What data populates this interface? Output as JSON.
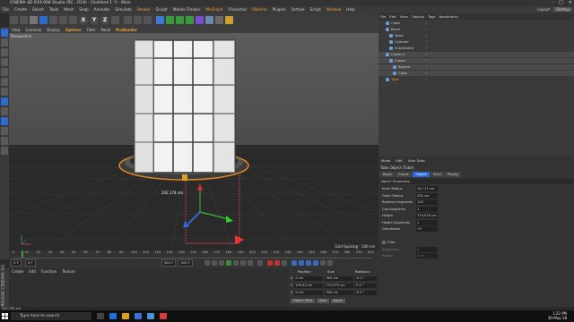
{
  "window": {
    "title": "CINEMA 4D R19.068 Studio (RC - R19) - [Untitled 1 *] - Main"
  },
  "menubar": {
    "items": [
      "File",
      "Create",
      "Select",
      "Tools",
      "Mesh",
      "Snap",
      "Animate",
      "Simulate",
      "Render",
      "Sculpt",
      "Motion Tracker",
      "MoGraph",
      "Character",
      "Pipeline",
      "Plugins",
      "Octane",
      "Script",
      "Window",
      "Help"
    ],
    "layout_label": "Layout:",
    "layout_value": "Startup"
  },
  "toolbar": {
    "x": "X",
    "y": "Y",
    "z": "Z"
  },
  "viewport": {
    "menu": [
      "View",
      "Cameras",
      "Display",
      "Options",
      "Filter",
      "Panel",
      "ProRender"
    ],
    "label": "Perspective",
    "measure": "242.174 cm",
    "grid_spacing": "Grid Spacing : 100 cm"
  },
  "timeline": {
    "ticks": [
      "0",
      "10",
      "20",
      "30",
      "40",
      "50",
      "60",
      "70",
      "80",
      "90",
      "100",
      "110",
      "120",
      "130",
      "140",
      "150",
      "160",
      "170",
      "180",
      "190",
      "200",
      "210",
      "220",
      "230",
      "240",
      "250",
      "260",
      "270",
      "280",
      "290",
      "300"
    ],
    "start": "0 F",
    "current": "0 F",
    "end": "300 F",
    "end2": "300 F",
    "frame": "0 F"
  },
  "material_panel": {
    "menu": [
      "Create",
      "Edit",
      "Function",
      "Texture"
    ]
  },
  "coordinates": {
    "headers": [
      "Position",
      "Size",
      "Rotation"
    ],
    "rows": [
      {
        "axis": "X",
        "pos": "0 cm",
        "size": "300 cm",
        "rot": "H  0 °"
      },
      {
        "axis": "Y",
        "pos": "193.42 cm",
        "size": "774.075 cm",
        "rot": "P  0 °"
      },
      {
        "axis": "Z",
        "pos": "0 cm",
        "size": "300 cm",
        "rot": "B  0 °"
      }
    ],
    "mode": "Object (Rel)",
    "size_mode": "Size",
    "apply": "Apply"
  },
  "objects": {
    "menu": [
      "File",
      "Edit",
      "View",
      "Objects",
      "Tags",
      "Bookmarks"
    ],
    "items": [
      {
        "name": "Cube",
        "indent": 2,
        "selected": false,
        "highlight": false
      },
      {
        "name": "Bend",
        "indent": 2,
        "selected": false,
        "highlight": false
      },
      {
        "name": "Twist",
        "indent": 3,
        "selected": false,
        "highlight": false
      },
      {
        "name": "Cylinder",
        "indent": 3,
        "selected": false,
        "highlight": false
      },
      {
        "name": "Subdivided",
        "indent": 3,
        "selected": false,
        "highlight": false
      },
      {
        "name": "Cloner.1",
        "indent": 2,
        "selected": true,
        "highlight": false
      },
      {
        "name": "Cloner",
        "indent": 3,
        "selected": true,
        "highlight": false
      },
      {
        "name": "Sphere",
        "indent": 4,
        "selected": true,
        "highlight": false
      },
      {
        "name": "Cube",
        "indent": 4,
        "selected": true,
        "highlight": false
      },
      {
        "name": "Tube",
        "indent": 2,
        "selected": false,
        "highlight": true
      }
    ]
  },
  "attributes": {
    "menu": [
      "Mode",
      "Edit",
      "User Data"
    ],
    "title": "Tube Object [Tube]",
    "tabs": [
      {
        "label": "Basic",
        "active": false
      },
      {
        "label": "Coord.",
        "active": false
      },
      {
        "label": "Object",
        "active": true
      },
      {
        "label": "Slice",
        "active": false
      },
      {
        "label": "Phong",
        "active": false
      }
    ],
    "section": "Object Properties",
    "rows": [
      {
        "label": "Inner Radius",
        "value": "247.17 cm",
        "type": "field"
      },
      {
        "label": "Outer Radius",
        "value": "250 cm",
        "type": "field"
      },
      {
        "label": "Rotation Segments",
        "value": "125",
        "type": "field"
      },
      {
        "label": "Cap Segments",
        "value": "1",
        "type": "field"
      },
      {
        "label": "Height",
        "value": "774.076 cm",
        "type": "field"
      },
      {
        "label": "Height Segments",
        "value": "1",
        "type": "field"
      },
      {
        "label": "Orientation",
        "value": "+Y",
        "type": "field"
      },
      {
        "label": "",
        "value": "",
        "type": "spacer"
      },
      {
        "label": "Fillet",
        "value": "",
        "type": "check"
      },
      {
        "label": "Segments",
        "value": "5",
        "type": "disabled"
      },
      {
        "label": "Radius",
        "value": "5 cm",
        "type": "disabled"
      }
    ]
  },
  "status": {
    "text": "242.735 cm"
  },
  "brand": {
    "text": "MAXON CINEMA 4D"
  },
  "taskbar": {
    "search_placeholder": "Type here to search",
    "time": "1:22 PM",
    "date": "30-May-18",
    "accent": "#2d6bd0"
  }
}
